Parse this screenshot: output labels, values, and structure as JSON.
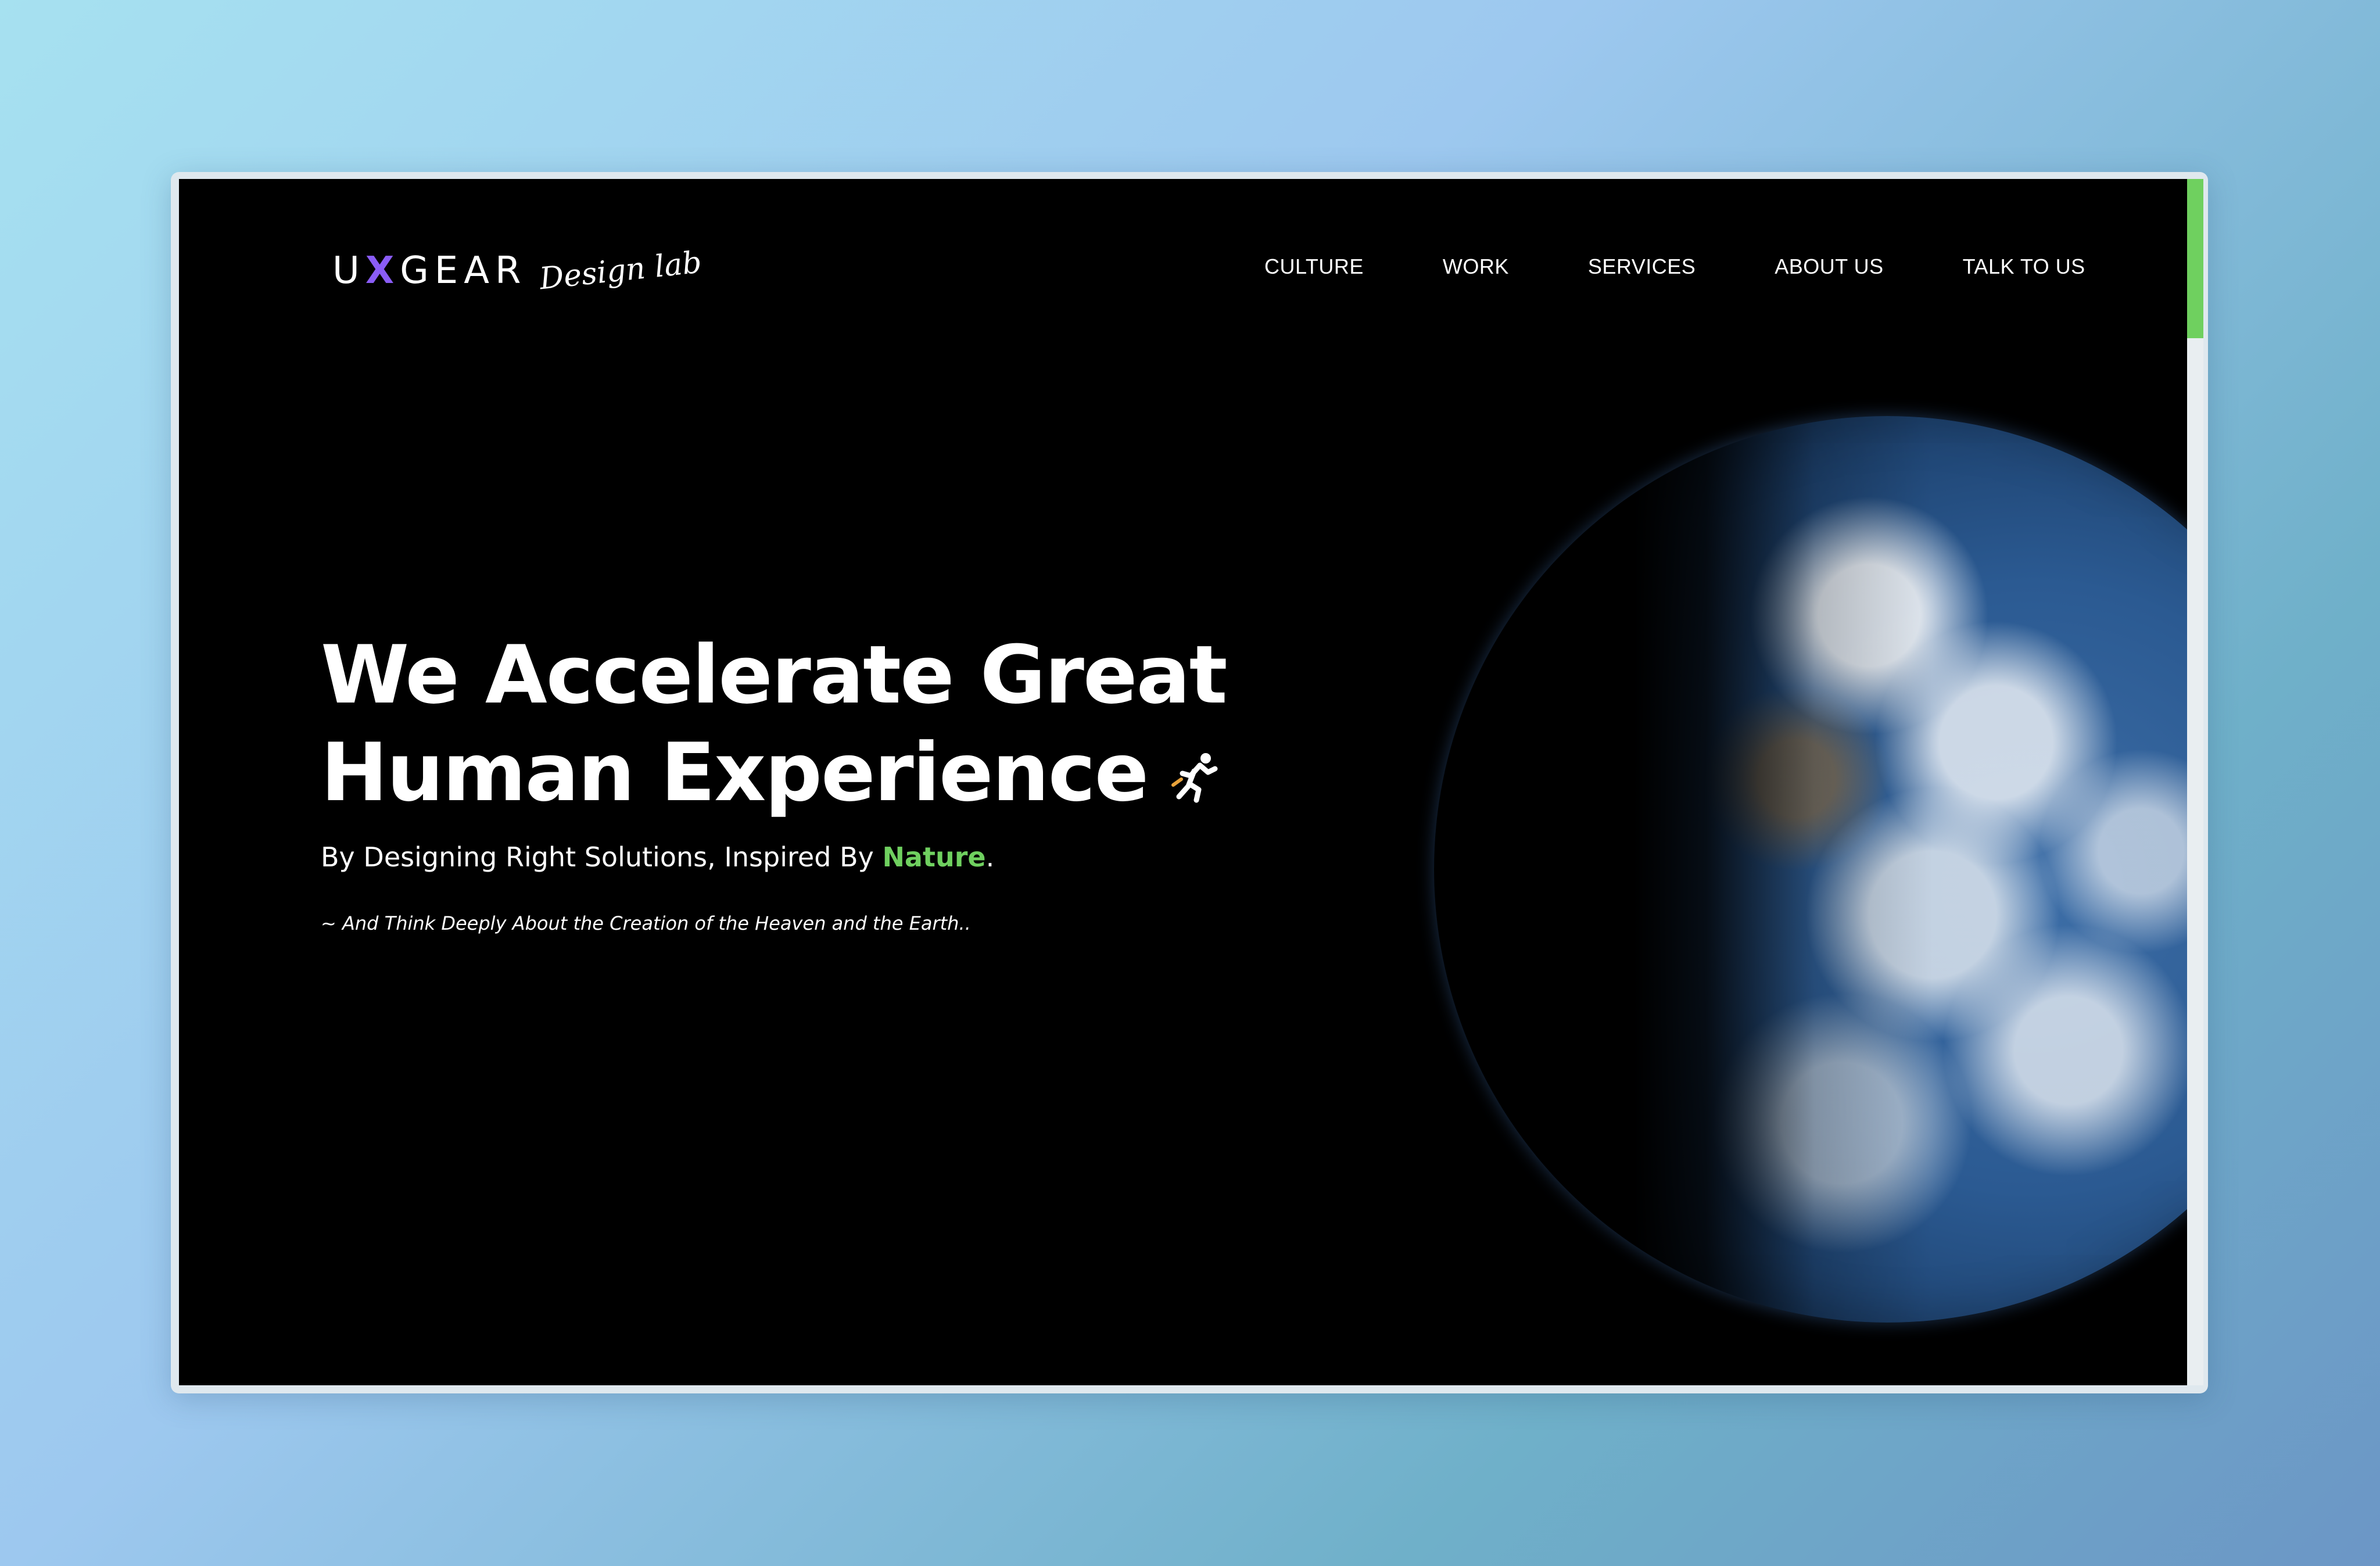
{
  "brand": {
    "logo_u": "U",
    "logo_x": "X",
    "logo_rest": "GEAR",
    "logo_script": "Design lab",
    "accent_color": "#6fd05f",
    "logo_x_color": "#8a5cf6"
  },
  "nav": {
    "items": [
      {
        "label": "CULTURE"
      },
      {
        "label": "WORK"
      },
      {
        "label": "SERVICES"
      },
      {
        "label": "ABOUT US"
      },
      {
        "label": "TALK TO US"
      }
    ]
  },
  "hero": {
    "title_line1": "We Accelerate Great",
    "title_line2": "Human Experience",
    "title_icon": "runner-icon",
    "subtitle_before": "By Designing Right Solutions, Inspired By ",
    "subtitle_highlight": "Nature",
    "subtitle_after": ".",
    "quote": "~ And Think Deeply About the Creation of the Heaven and the Earth..",
    "image": "earth-globe"
  }
}
